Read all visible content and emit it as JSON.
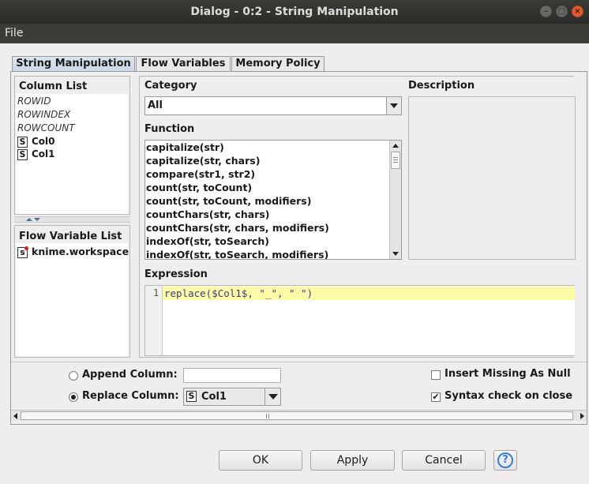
{
  "window": {
    "title": "Dialog - 0:2 - String Manipulation"
  },
  "menu": {
    "file": "File"
  },
  "tabs": [
    "String Manipulation",
    "Flow Variables",
    "Memory Policy"
  ],
  "column_list": {
    "title": "Column List",
    "special": [
      "ROWID",
      "ROWINDEX",
      "ROWCOUNT"
    ],
    "columns": [
      {
        "type": "S",
        "name": "Col0"
      },
      {
        "type": "S",
        "name": "Col1"
      }
    ]
  },
  "flow_variable_list": {
    "title": "Flow Variable List",
    "items": [
      {
        "type": "s",
        "name": "knime.workspace"
      }
    ]
  },
  "category": {
    "label": "Category",
    "value": "All"
  },
  "description": {
    "label": "Description"
  },
  "function": {
    "label": "Function",
    "items": [
      "capitalize(str)",
      "capitalize(str, chars)",
      "compare(str1, str2)",
      "count(str, toCount)",
      "count(str, toCount, modifiers)",
      "countChars(str, chars)",
      "countChars(str, chars, modifiers)",
      "indexOf(str, toSearch)",
      "indexOf(str, toSearch, modifiers)"
    ]
  },
  "expression": {
    "label": "Expression",
    "line_number": "1",
    "code": "replace($Col1$, \"_\", \" \")"
  },
  "options": {
    "append_label": "Append Column:",
    "append_value": "",
    "replace_label": "Replace Column:",
    "replace_value": "Col1",
    "replace_type": "S",
    "append_selected": false,
    "replace_selected": true,
    "insert_missing_label": "Insert Missing As Null",
    "insert_missing_checked": false,
    "syntax_check_label": "Syntax check on close",
    "syntax_check_checked": true
  },
  "buttons": {
    "ok": "OK",
    "apply": "Apply",
    "cancel": "Cancel",
    "help": "?"
  },
  "colors": {
    "expression_highlight": "#fcfba6",
    "tab_active": "#c9d6e6",
    "titlebar": "#2d2c2a"
  }
}
